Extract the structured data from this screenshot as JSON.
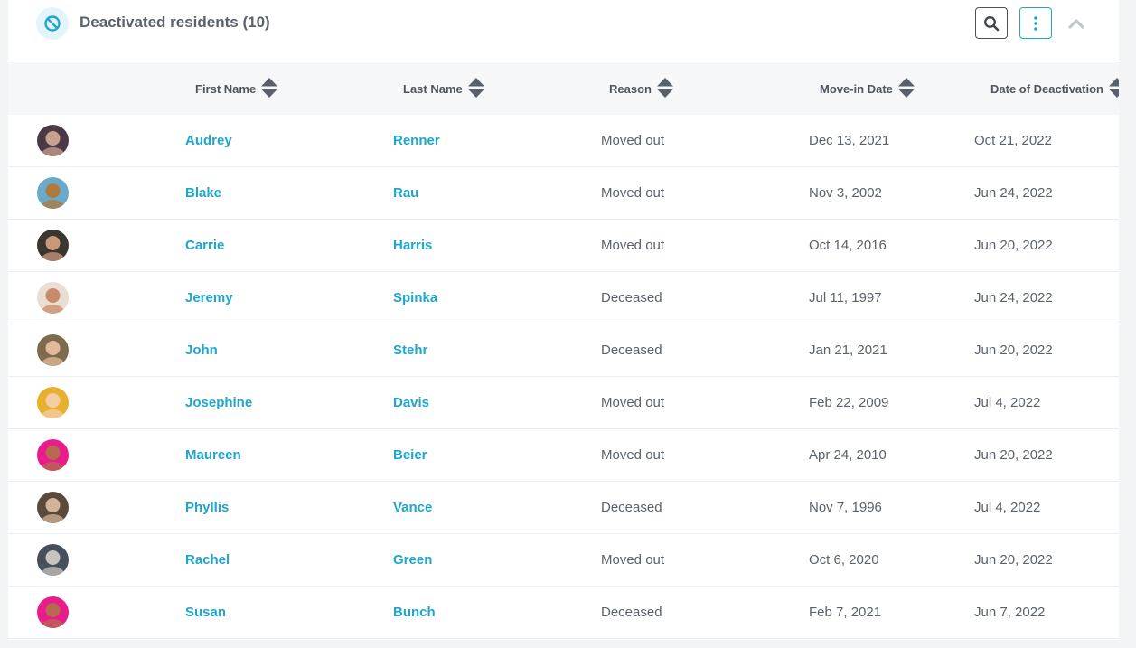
{
  "header": {
    "title": "Deactivated residents (10)",
    "icon": "ban-icon",
    "accent": "#1fa6cc"
  },
  "columns": [
    {
      "label": "First Name"
    },
    {
      "label": "Last Name"
    },
    {
      "label": "Reason"
    },
    {
      "label": "Move-in Date"
    },
    {
      "label": "Date of Deactivation"
    }
  ],
  "rows": [
    {
      "first": "Audrey",
      "last": "Renner",
      "reason": "Moved out",
      "move_in": "Dec 13, 2021",
      "deactivated": "Oct 21, 2022",
      "avatar_colors": [
        "#4a3a48",
        "#c9a28e"
      ]
    },
    {
      "first": "Blake",
      "last": "Rau",
      "reason": "Moved out",
      "move_in": "Nov 3, 2002",
      "deactivated": "Jun 24, 2022",
      "avatar_colors": [
        "#6aa9c9",
        "#b07a3c"
      ]
    },
    {
      "first": "Carrie",
      "last": "Harris",
      "reason": "Moved out",
      "move_in": "Oct 14, 2016",
      "deactivated": "Jun 20, 2022",
      "avatar_colors": [
        "#3b3630",
        "#c99a7a"
      ]
    },
    {
      "first": "Jeremy",
      "last": "Spinka",
      "reason": "Deceased",
      "move_in": "Jul 11, 1997",
      "deactivated": "Jun 24, 2022",
      "avatar_colors": [
        "#e9ddd4",
        "#c78b6a"
      ]
    },
    {
      "first": "John",
      "last": "Stehr",
      "reason": "Deceased",
      "move_in": "Jan 21, 2021",
      "deactivated": "Jun 20, 2022",
      "avatar_colors": [
        "#7d6b4c",
        "#e2b99a"
      ]
    },
    {
      "first": "Josephine",
      "last": "Davis",
      "reason": "Moved out",
      "move_in": "Feb 22, 2009",
      "deactivated": "Jul 4, 2022",
      "avatar_colors": [
        "#e9b030",
        "#f1cfa7"
      ]
    },
    {
      "first": "Maureen",
      "last": "Beier",
      "reason": "Moved out",
      "move_in": "Apr 24, 2010",
      "deactivated": "Jun 20, 2022",
      "avatar_colors": [
        "#e81c8a",
        "#b56a50"
      ]
    },
    {
      "first": "Phyllis",
      "last": "Vance",
      "reason": "Deceased",
      "move_in": "Nov 7, 1996",
      "deactivated": "Jul 4, 2022",
      "avatar_colors": [
        "#5a4a3c",
        "#d3b39a"
      ]
    },
    {
      "first": "Rachel",
      "last": "Green",
      "reason": "Moved out",
      "move_in": "Oct 6, 2020",
      "deactivated": "Jun 20, 2022",
      "avatar_colors": [
        "#45505c",
        "#c9c3bd"
      ]
    },
    {
      "first": "Susan",
      "last": "Bunch",
      "reason": "Deceased",
      "move_in": "Feb 7, 2021",
      "deactivated": "Jun 7, 2022",
      "avatar_colors": [
        "#e81c8a",
        "#b56a50"
      ]
    }
  ]
}
